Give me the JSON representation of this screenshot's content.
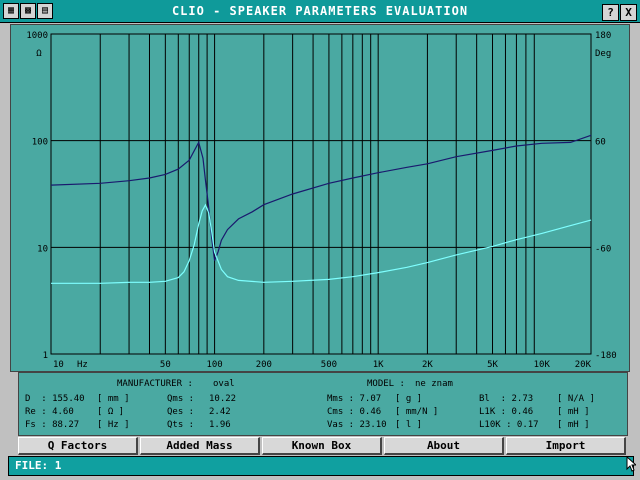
{
  "window": {
    "title": "CLIO - SPEAKER PARAMETERS EVALUATION",
    "help_label": "?",
    "close_label": "X"
  },
  "chart_data": {
    "type": "line",
    "xscale": "log",
    "yscale_left": "log",
    "xlim": [
      10,
      20000
    ],
    "ylim_left": [
      1,
      1000
    ],
    "ylim_right": [
      -180,
      180
    ],
    "ylabel_left": "Ω",
    "ylabel_right": "Deg",
    "x_unit_label": "Hz",
    "xticks": [
      {
        "v": 10,
        "label": "10"
      },
      {
        "v": 50,
        "label": "50"
      },
      {
        "v": 100,
        "label": "100"
      },
      {
        "v": 200,
        "label": "200"
      },
      {
        "v": 500,
        "label": "500"
      },
      {
        "v": 1000,
        "label": "1K"
      },
      {
        "v": 2000,
        "label": "2K"
      },
      {
        "v": 5000,
        "label": "5K"
      },
      {
        "v": 10000,
        "label": "10K"
      },
      {
        "v": 20000,
        "label": "20K"
      }
    ],
    "yticks_left": [
      {
        "v": 1000,
        "label": "1000"
      },
      {
        "v": 100,
        "label": "100"
      },
      {
        "v": 10,
        "label": "10"
      },
      {
        "v": 1,
        "label": "1"
      }
    ],
    "yticks_right": [
      {
        "v": 180,
        "label": "180"
      },
      {
        "v": 60,
        "label": "60"
      },
      {
        "v": -60,
        "label": "-60"
      },
      {
        "v": -180,
        "label": "-180"
      }
    ],
    "grid": true,
    "series": [
      {
        "color": "#1a1a6e",
        "axis": "right",
        "x": [
          10,
          20,
          30,
          40,
          50,
          60,
          70,
          80,
          85,
          88,
          92,
          96,
          100,
          105,
          110,
          120,
          140,
          170,
          200,
          300,
          500,
          700,
          1000,
          1500,
          2000,
          3000,
          5000,
          7000,
          10000,
          15000,
          20000
        ],
        "y": [
          10,
          12,
          15,
          18,
          22,
          28,
          38,
          58,
          40,
          15,
          -15,
          -50,
          -75,
          -65,
          -52,
          -40,
          -28,
          -20,
          -12,
          0,
          12,
          18,
          24,
          30,
          34,
          42,
          49,
          54,
          57,
          58,
          66
        ]
      },
      {
        "color": "#7fffff",
        "axis": "left",
        "x": [
          10,
          20,
          30,
          40,
          50,
          60,
          65,
          70,
          75,
          80,
          84,
          88,
          92,
          96,
          100,
          110,
          120,
          140,
          200,
          300,
          500,
          700,
          1000,
          1500,
          2000,
          3000,
          5000,
          7000,
          10000,
          15000,
          20000
        ],
        "y": [
          4.6,
          4.6,
          4.7,
          4.7,
          4.8,
          5.2,
          5.9,
          7.5,
          10.5,
          16.5,
          22,
          25,
          21,
          14,
          9,
          6.2,
          5.3,
          4.9,
          4.7,
          4.8,
          5.0,
          5.3,
          5.8,
          6.5,
          7.2,
          8.5,
          10.2,
          11.8,
          13.5,
          16,
          18
        ]
      }
    ]
  },
  "info": {
    "manufacturer_label": "MANUFACTURER :",
    "manufacturer_value": "oval",
    "model_label": "MODEL :",
    "model_value": "ne znam",
    "rows": [
      [
        "D  : 155.40",
        "[ mm ]",
        "Qms :",
        "10.22",
        "Mms : 7.07",
        "[ g ]",
        "Bl  : 2.73",
        "[ N/A ]"
      ],
      [
        "Re : 4.60",
        "[ Ω ]",
        "Qes :",
        "2.42",
        "Cms : 0.46",
        "[ mm/N ]",
        "L1K : 0.46",
        "[ mH ]"
      ],
      [
        "Fs : 88.27",
        "[ Hz ]",
        "Qts :",
        "1.96",
        "Vas : 23.10",
        "[ l ]",
        "L10K : 0.17",
        "[ mH ]"
      ]
    ]
  },
  "buttons": [
    {
      "id": "q-factors",
      "label": "Q Factors"
    },
    {
      "id": "added-mass",
      "label": "Added Mass"
    },
    {
      "id": "known-box",
      "label": "Known Box"
    },
    {
      "id": "about",
      "label": "About"
    },
    {
      "id": "import",
      "label": "Import"
    }
  ],
  "status": {
    "text": "FILE: 1"
  }
}
